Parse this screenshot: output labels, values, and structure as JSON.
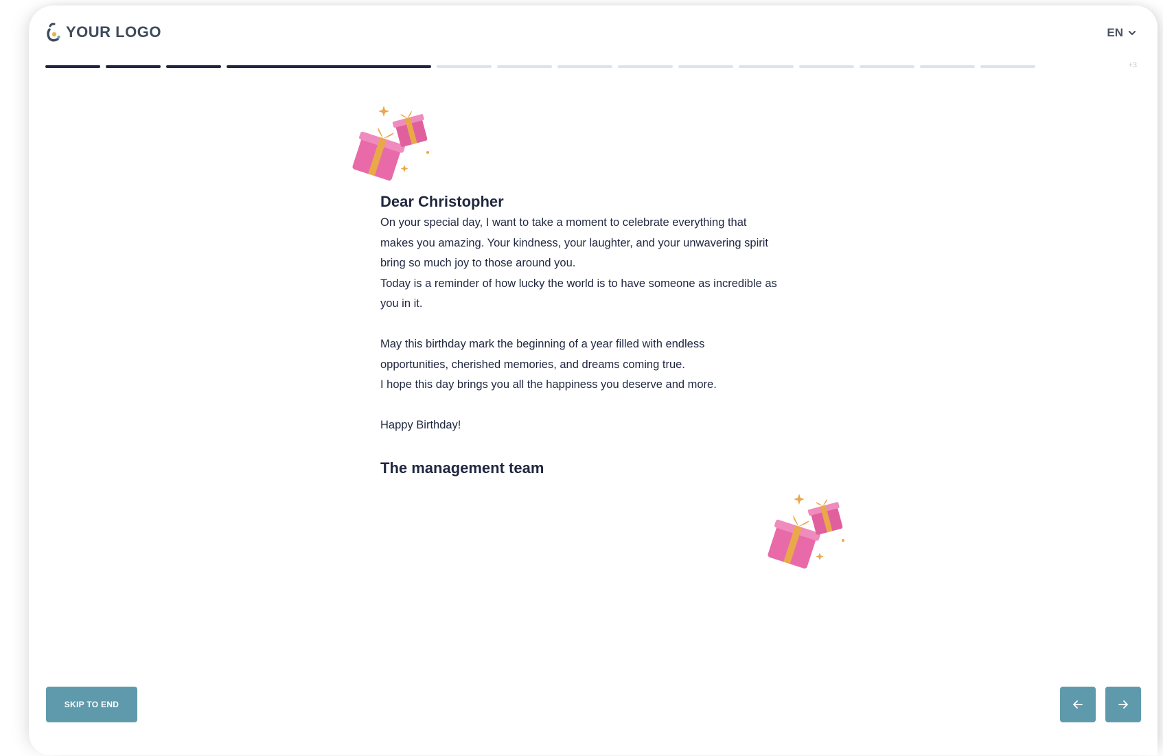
{
  "header": {
    "logo_text": "YOUR LOGO",
    "language": "EN"
  },
  "progress": {
    "total_segments": 16,
    "completed_segments": 4,
    "current_segment": 4,
    "hidden_count_label": "+3"
  },
  "letter": {
    "greeting": "Dear Christopher",
    "paragraphs": [
      "On your special day, I want to take a moment to celebrate everything that",
      "makes you amazing. Your kindness, your laughter, and your unwavering spirit",
      "bring so much joy to those around you.",
      "Today is a reminder of how lucky the world is to have someone as incredible as",
      "you in it.",
      "May this birthday mark the beginning of a year filled with endless",
      "opportunities, cherished memories, and dreams coming true.",
      "I hope this day brings you all the happiness you deserve and more.",
      "Happy Birthday!"
    ],
    "signoff": "The management team"
  },
  "footer": {
    "skip_label": "SKIP TO END"
  },
  "icons": {
    "logo": "logo-mark-icon",
    "language_caret": "chevron-down-icon",
    "previous": "arrow-left-icon",
    "next": "arrow-right-icon",
    "decoration": "gift-icon"
  },
  "colors": {
    "text_dark": "#1f2740",
    "progress_done": "#1f2740",
    "progress_todo": "#dde3ea",
    "button": "#5f9aac",
    "gift_pink": "#e86aa8",
    "ribbon_gold": "#e9a84a"
  }
}
